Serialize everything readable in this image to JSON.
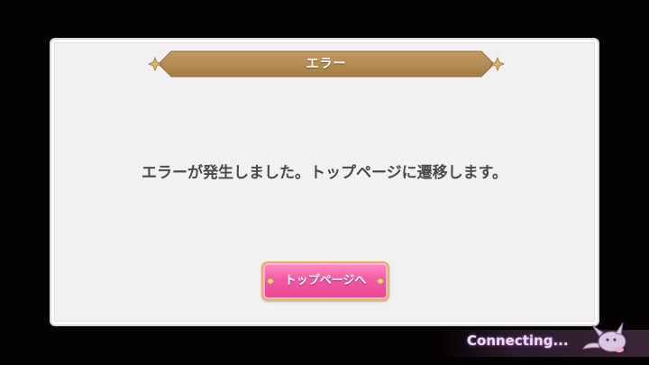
{
  "dialog": {
    "title": "エラー",
    "message": "エラーが発生しました。トップページに遷移します。",
    "button_label": "トップページへ"
  },
  "status": {
    "text": "Connecting..."
  },
  "colors": {
    "banner": "#b48c55",
    "button": "#f25aa6",
    "button_border": "#e8b25a",
    "status_glow": "#b36acf"
  },
  "icons": {
    "banner_ornament": "gold-sparkle-icon",
    "loading_mascot": "mascot-icon"
  }
}
